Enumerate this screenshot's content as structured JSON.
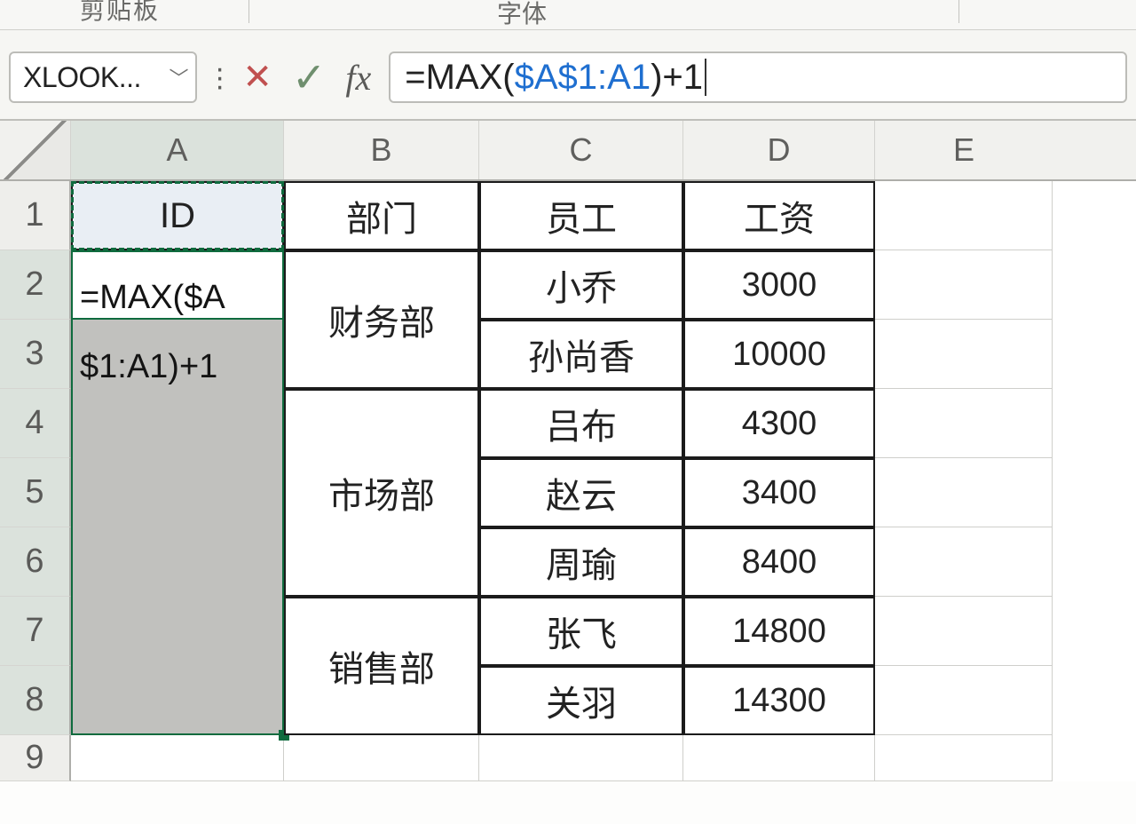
{
  "ribbon": {
    "left_fragment": "剪贴板",
    "right_fragment": "字体"
  },
  "formula_bar": {
    "name_box": "XLOOK...",
    "cancel_glyph": "✕",
    "accept_glyph": "✓",
    "fx_label": "fx",
    "formula_prefix": "=MAX(",
    "formula_ref": "$A$1:A1",
    "formula_suffix": ")+1"
  },
  "columns": [
    "A",
    "B",
    "C",
    "D",
    "E"
  ],
  "rows": [
    "1",
    "2",
    "3",
    "4",
    "5",
    "6",
    "7",
    "8",
    "9"
  ],
  "headers": {
    "A": "ID",
    "B": "部门",
    "C": "员工",
    "D": "工资"
  },
  "editing_cell": {
    "line1": "=MAX($A",
    "line2": "$1:A1)+1"
  },
  "data": [
    {
      "dept": "财务部",
      "rows": [
        {
          "emp": "小乔",
          "sal": "3000"
        },
        {
          "emp": "孙尚香",
          "sal": "10000"
        }
      ]
    },
    {
      "dept": "市场部",
      "rows": [
        {
          "emp": "吕布",
          "sal": "4300"
        },
        {
          "emp": "赵云",
          "sal": "3400"
        },
        {
          "emp": "周瑜",
          "sal": "8400"
        }
      ]
    },
    {
      "dept": "销售部",
      "rows": [
        {
          "emp": "张飞",
          "sal": "14800"
        },
        {
          "emp": "关羽",
          "sal": "14300"
        }
      ]
    }
  ],
  "chart_data": {
    "type": "table",
    "columns": [
      "ID",
      "部门",
      "员工",
      "工资"
    ],
    "rows": [
      [
        "",
        "财务部",
        "小乔",
        3000
      ],
      [
        "",
        "财务部",
        "孙尚香",
        10000
      ],
      [
        "",
        "市场部",
        "吕布",
        4300
      ],
      [
        "",
        "市场部",
        "赵云",
        3400
      ],
      [
        "",
        "市场部",
        "周瑜",
        8400
      ],
      [
        "",
        "销售部",
        "张飞",
        14800
      ],
      [
        "",
        "销售部",
        "关羽",
        14300
      ]
    ]
  }
}
